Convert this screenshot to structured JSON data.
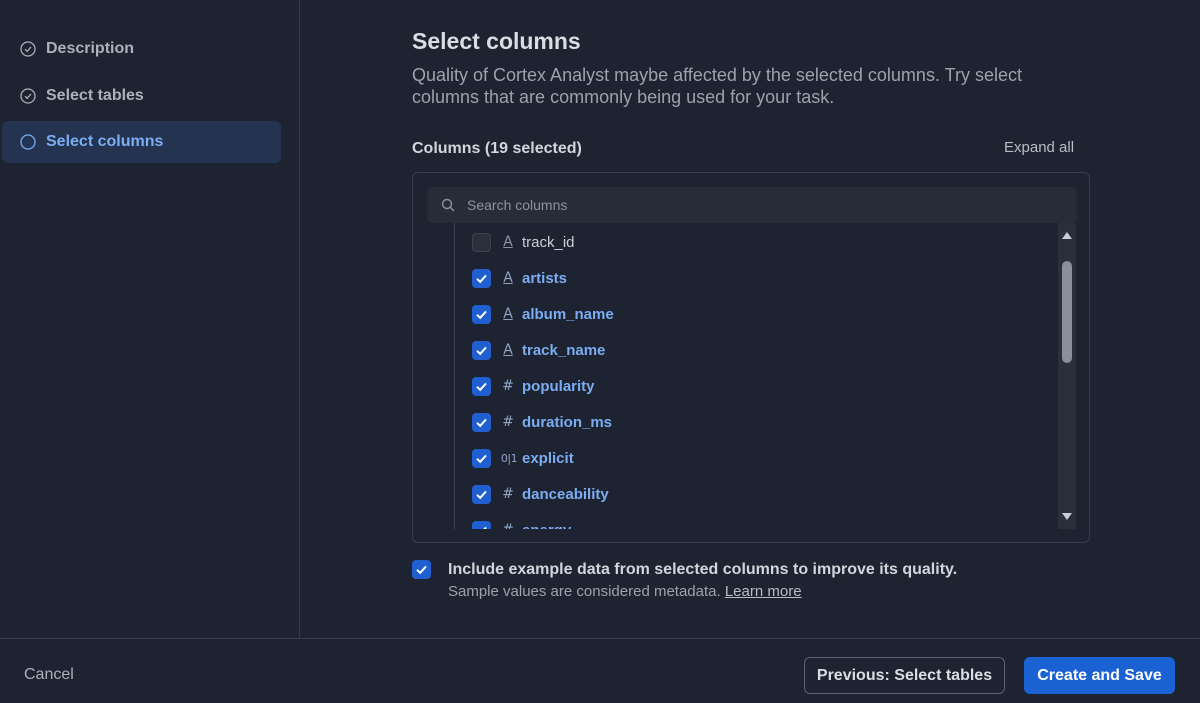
{
  "sidebar": {
    "steps": [
      {
        "label": "Description",
        "state": "completed",
        "icon": "check-circle-icon"
      },
      {
        "label": "Select tables",
        "state": "completed",
        "icon": "check-circle-icon"
      },
      {
        "label": "Select columns",
        "state": "active",
        "icon": "circle-icon"
      }
    ]
  },
  "main": {
    "title": "Select columns",
    "subtitle": "Quality of Cortex Analyst maybe affected by the selected columns. Try select columns that are commonly being used for your task.",
    "columns_header": "Columns (19 selected)",
    "expand_all": "Expand all",
    "search": {
      "placeholder": "Search columns",
      "value": "",
      "icon": "search-icon"
    },
    "columns": [
      {
        "name": "track_id",
        "type": "text",
        "type_glyph": "A",
        "checked": false
      },
      {
        "name": "artists",
        "type": "text",
        "type_glyph": "A",
        "checked": true
      },
      {
        "name": "album_name",
        "type": "text",
        "type_glyph": "A",
        "checked": true
      },
      {
        "name": "track_name",
        "type": "text",
        "type_glyph": "A",
        "checked": true
      },
      {
        "name": "popularity",
        "type": "number",
        "type_glyph": "#",
        "checked": true
      },
      {
        "name": "duration_ms",
        "type": "number",
        "type_glyph": "#",
        "checked": true
      },
      {
        "name": "explicit",
        "type": "boolean",
        "type_glyph": "0|1",
        "checked": true
      },
      {
        "name": "danceability",
        "type": "number",
        "type_glyph": "#",
        "checked": true
      },
      {
        "name": "energy",
        "type": "number",
        "type_glyph": "#",
        "checked": true
      }
    ],
    "include_example": {
      "checked": true,
      "label": "Include example data from selected columns to improve its quality.",
      "note": "Sample values are considered metadata.",
      "learn_more": "Learn more"
    }
  },
  "footer": {
    "cancel": "Cancel",
    "previous": "Previous: Select tables",
    "create": "Create and Save"
  },
  "colors": {
    "background": "#1d2330",
    "accent": "#1a62d4",
    "selected_text": "#7cacf2",
    "active_step_bg": "#233350"
  }
}
